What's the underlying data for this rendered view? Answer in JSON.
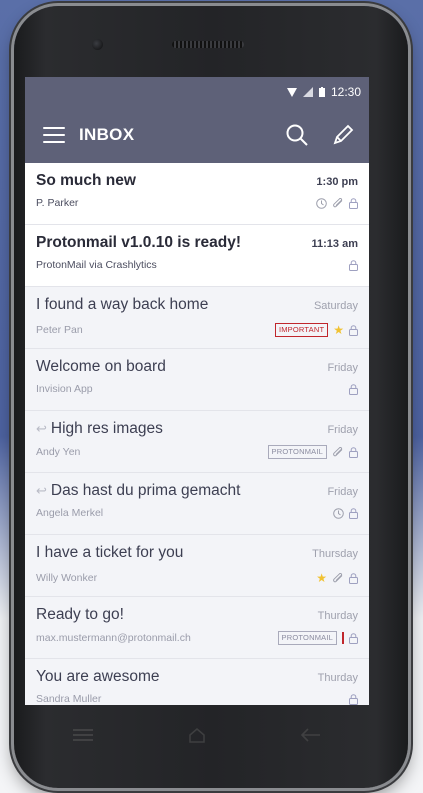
{
  "status": {
    "time": "12:30",
    "icons": [
      "wifi-icon",
      "signal-icon",
      "battery-icon"
    ]
  },
  "header": {
    "title": "INBOX",
    "icons": [
      "menu-icon",
      "search-icon",
      "compose-icon"
    ]
  },
  "colors": {
    "appbar": "#5e6178",
    "important": "#c0262c",
    "star": "#f1c232"
  },
  "messages": [
    {
      "subject": "So much new",
      "sender": "P. Parker",
      "time": "1:30 pm",
      "unread": true,
      "icons": [
        "clock-icon",
        "attachment-icon",
        "lock-icon"
      ]
    },
    {
      "subject": "Protonmail v1.0.10 is ready!",
      "sender": "ProtonMail via Crashlytics",
      "time": "11:13 am",
      "unread": true,
      "icons": [
        "lock-icon"
      ]
    },
    {
      "subject": "I found a way back home",
      "sender": "Peter Pan",
      "time": "Saturday",
      "label": "IMPORTANT",
      "icons": [
        "star-icon",
        "lock-icon"
      ]
    },
    {
      "subject": "Welcome on board",
      "sender": "Invision App",
      "time": "Friday",
      "icons": [
        "lock-icon"
      ]
    },
    {
      "subject": "High res images",
      "sender": "Andy Yen",
      "time": "Friday",
      "reply": true,
      "label": "PROTONMAIL",
      "icons": [
        "attachment-icon",
        "lock-icon"
      ]
    },
    {
      "subject": "Das hast du prima gemacht",
      "sender": "Angela Merkel",
      "time": "Friday",
      "reply": true,
      "icons": [
        "clock-icon",
        "lock-icon"
      ]
    },
    {
      "subject": "I have a ticket for you",
      "sender": "Willy Wonker",
      "time": "Thursday",
      "icons": [
        "star-icon",
        "attachment-icon",
        "lock-icon"
      ]
    },
    {
      "subject": "Ready to go!",
      "sender": "max.mustermann@protonmail.ch",
      "time": "Thurday",
      "label": "PROTONMAIL",
      "icons": [
        "lock-icon"
      ]
    },
    {
      "subject": "You are awesome",
      "sender": "Sandra Muller",
      "time": "Thurday",
      "icons": [
        "lock-icon"
      ]
    }
  ],
  "navbar": {
    "icons": [
      "menu-nav-icon",
      "home-nav-icon",
      "back-nav-icon"
    ]
  }
}
